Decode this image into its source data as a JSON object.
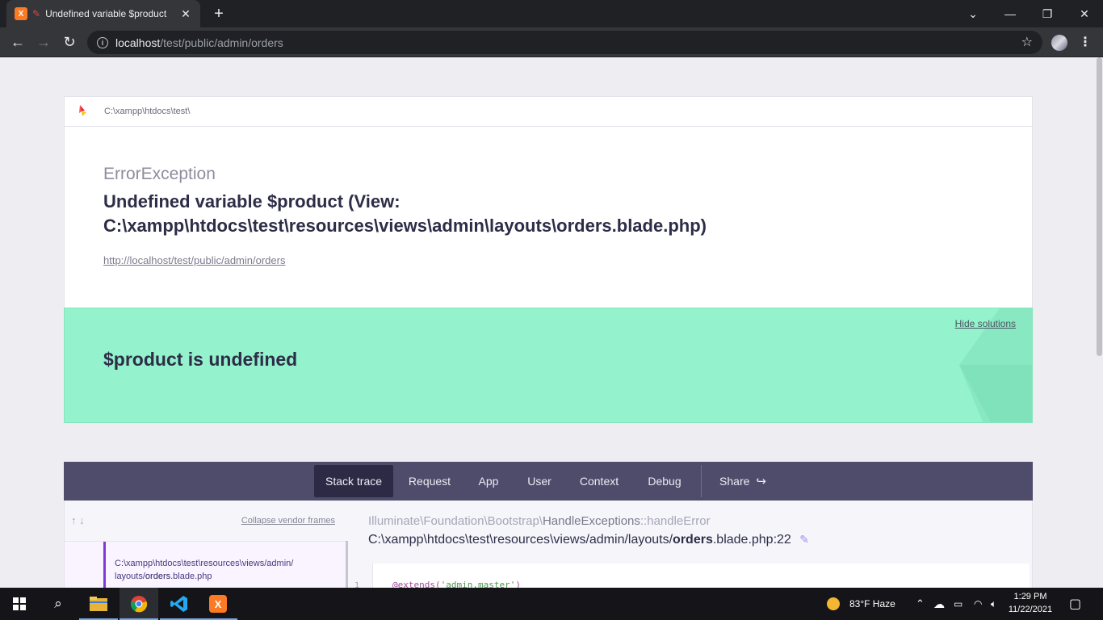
{
  "browser": {
    "tab_title": "Undefined variable $product",
    "tab_close": "✕",
    "new_tab": "+",
    "url_host": "localhost",
    "url_path": "/test/public/admin/orders"
  },
  "page": {
    "header_path": "C:\\xampp\\htdocs\\test\\",
    "error_class": "ErrorException",
    "error_message": "Undefined variable $product (View: C:\\xampp\\htdocs\\test\\resources\\views\\admin\\layouts\\orders.blade.php)",
    "error_url": "http://localhost/test/public/admin/orders",
    "solution_title": "$product is undefined",
    "hide_solutions": "Hide solutions",
    "tabs": [
      "Stack trace",
      "Request",
      "App",
      "User",
      "Context",
      "Debug"
    ],
    "share": "Share",
    "collapse_vendor": "Collapse vendor frames",
    "frame_path": "C:\\xampp\\htdocs\\test\\resources\\views/admin/",
    "frame_path2_prefix": "layouts/",
    "frame_path2_bold": "orders",
    "frame_path2_suffix": ".blade.php",
    "detail_namespace": "Illuminate\\Foundation\\Bootstrap\\",
    "detail_class": "HandleExceptions",
    "detail_method": "::handleError",
    "detail_file_prefix": "C:\\xampp\\htdocs\\test\\resources\\views/admin/layouts/",
    "detail_file_bold": "orders",
    "detail_file_suffix": ".blade.php:22",
    "code_line_number": "1",
    "code_keyword": "@extends(",
    "code_string": "'admin.master'",
    "code_close": ")"
  },
  "taskbar": {
    "weather": "83°F  Haze",
    "time": "1:29 PM",
    "date": "11/22/2021"
  },
  "colors": {
    "solution_bg": "#94f2cc",
    "nav_bg": "#4f4b6b",
    "accent_purple": "#7e3ad6"
  }
}
